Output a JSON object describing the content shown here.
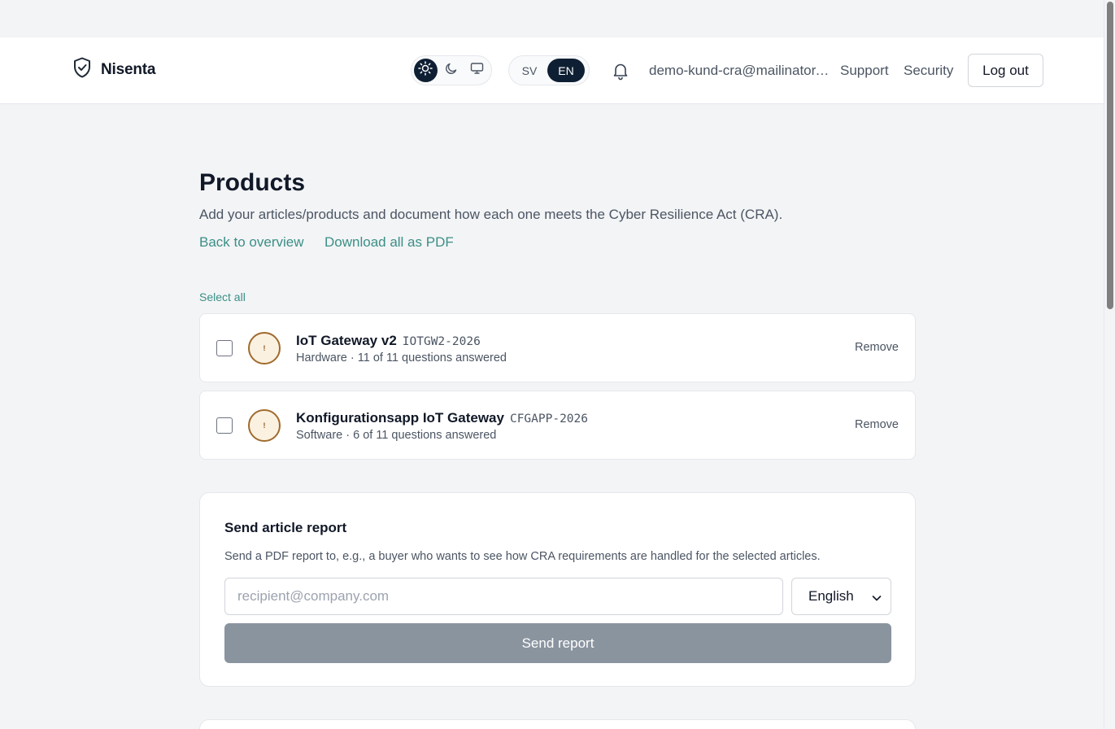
{
  "app": {
    "name": "Nisenta",
    "logo_icon": "shield-check-icon"
  },
  "header": {
    "theme_options": [
      {
        "icon": "sun-icon",
        "active": true
      },
      {
        "icon": "moon-icon",
        "active": false
      },
      {
        "icon": "monitor-icon",
        "active": false
      }
    ],
    "languages": [
      {
        "code": "SV",
        "active": false
      },
      {
        "code": "EN",
        "active": true
      }
    ],
    "notifications_icon": "bell-icon",
    "user_email": "demo-kund-cra@mailinator.com",
    "support_label": "Support",
    "security_label": "Security",
    "logout_label": "Log out"
  },
  "page": {
    "title": "Products",
    "description": "Add your articles/products and document how each one meets the Cyber Resilience Act (CRA).",
    "back_link": "Back to overview",
    "download_link": "Download all as PDF",
    "select_all": "Select all"
  },
  "products": [
    {
      "name": "IoT Gateway v2",
      "code": "IOTGW2-2026",
      "meta": "Hardware · 11 of 11 questions answered",
      "status_glyph": "!",
      "remove_label": "Remove"
    },
    {
      "name": "Konfigurationsapp IoT Gateway",
      "code": "CFGAPP-2026",
      "meta": "Software · 6 of 11 questions answered",
      "status_glyph": "!",
      "remove_label": "Remove"
    }
  ],
  "report": {
    "title": "Send article report",
    "description": "Send a PDF report to, e.g., a buyer who wants to see how CRA requirements are handled for the selected articles.",
    "email_placeholder": "recipient@company.com",
    "email_value": "",
    "language_selected": "English",
    "send_label": "Send report"
  },
  "colors": {
    "accent_link": "#3b8f86",
    "toggle_active": "#0f1f33",
    "status_ring": "#a06a2c",
    "send_button_disabled": "#8a949f"
  }
}
